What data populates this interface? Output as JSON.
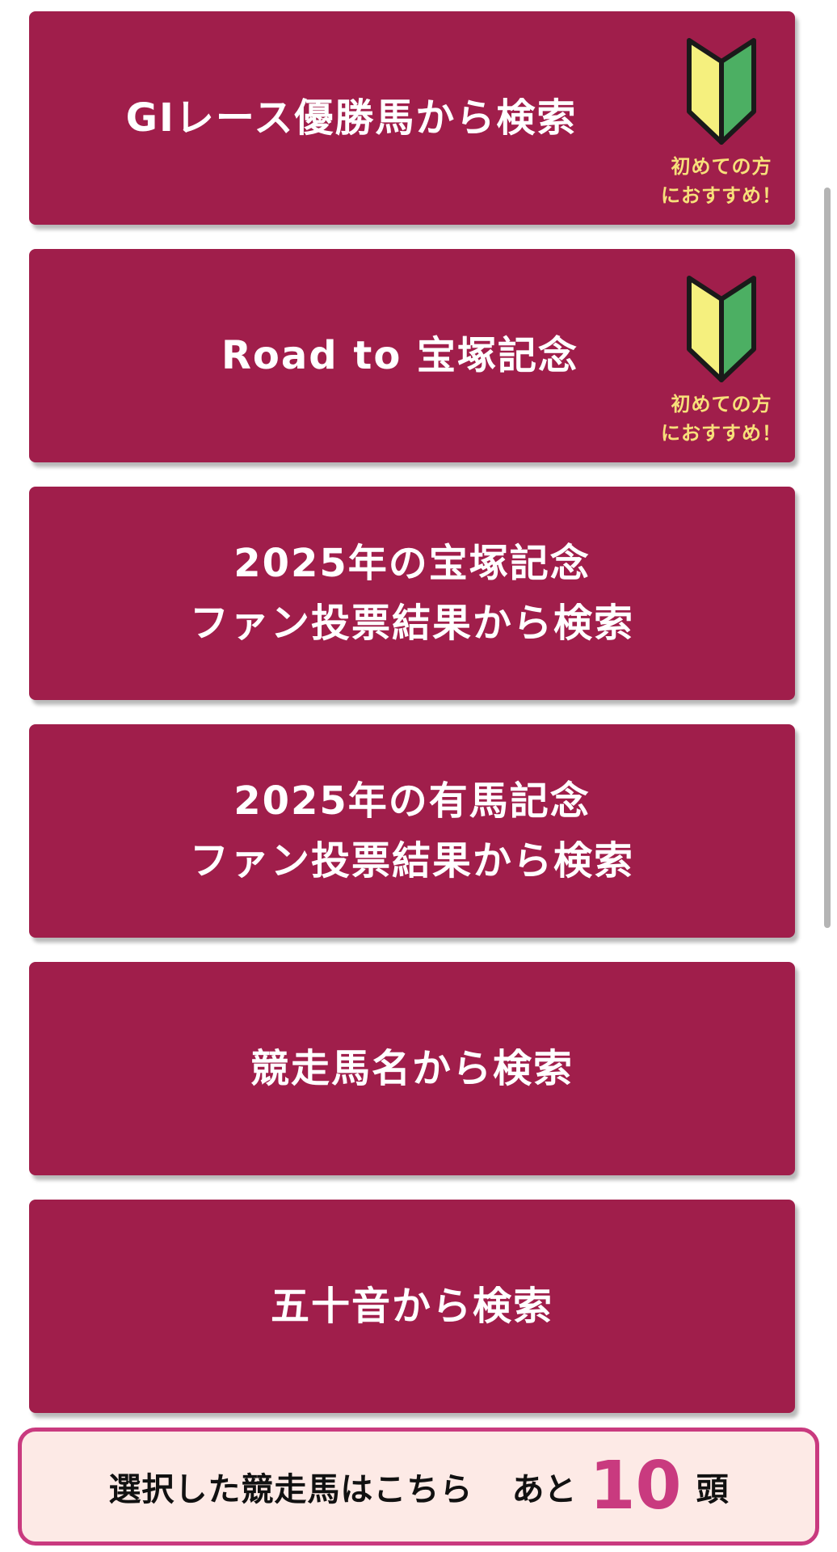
{
  "menu": {
    "items": [
      {
        "label_lines": [
          "GIレース優勝馬から検索"
        ],
        "beginner": true
      },
      {
        "label_lines": [
          "Road to 宝塚記念"
        ],
        "beginner": true
      },
      {
        "label_lines": [
          "2025年の宝塚記念",
          "ファン投票結果から検索"
        ],
        "beginner": false
      },
      {
        "label_lines": [
          "2025年の有馬記念",
          "ファン投票結果から検索"
        ],
        "beginner": false
      },
      {
        "label_lines": [
          "競走馬名から検索"
        ],
        "beginner": false
      },
      {
        "label_lines": [
          "五十音から検索"
        ],
        "beginner": false
      }
    ],
    "beginner_badge": {
      "line1": "初めての方",
      "line2": "におすすめ！"
    }
  },
  "selected_bar": {
    "label": "選択した競走馬はこちら",
    "remaining_prefix": "あと",
    "remaining_count": "10",
    "remaining_unit": "頭"
  },
  "colors": {
    "button_bg": "#a01e4b",
    "accent": "#c93a7f",
    "badge_text": "#f7e07a",
    "bar_bg": "#fdeae6"
  }
}
